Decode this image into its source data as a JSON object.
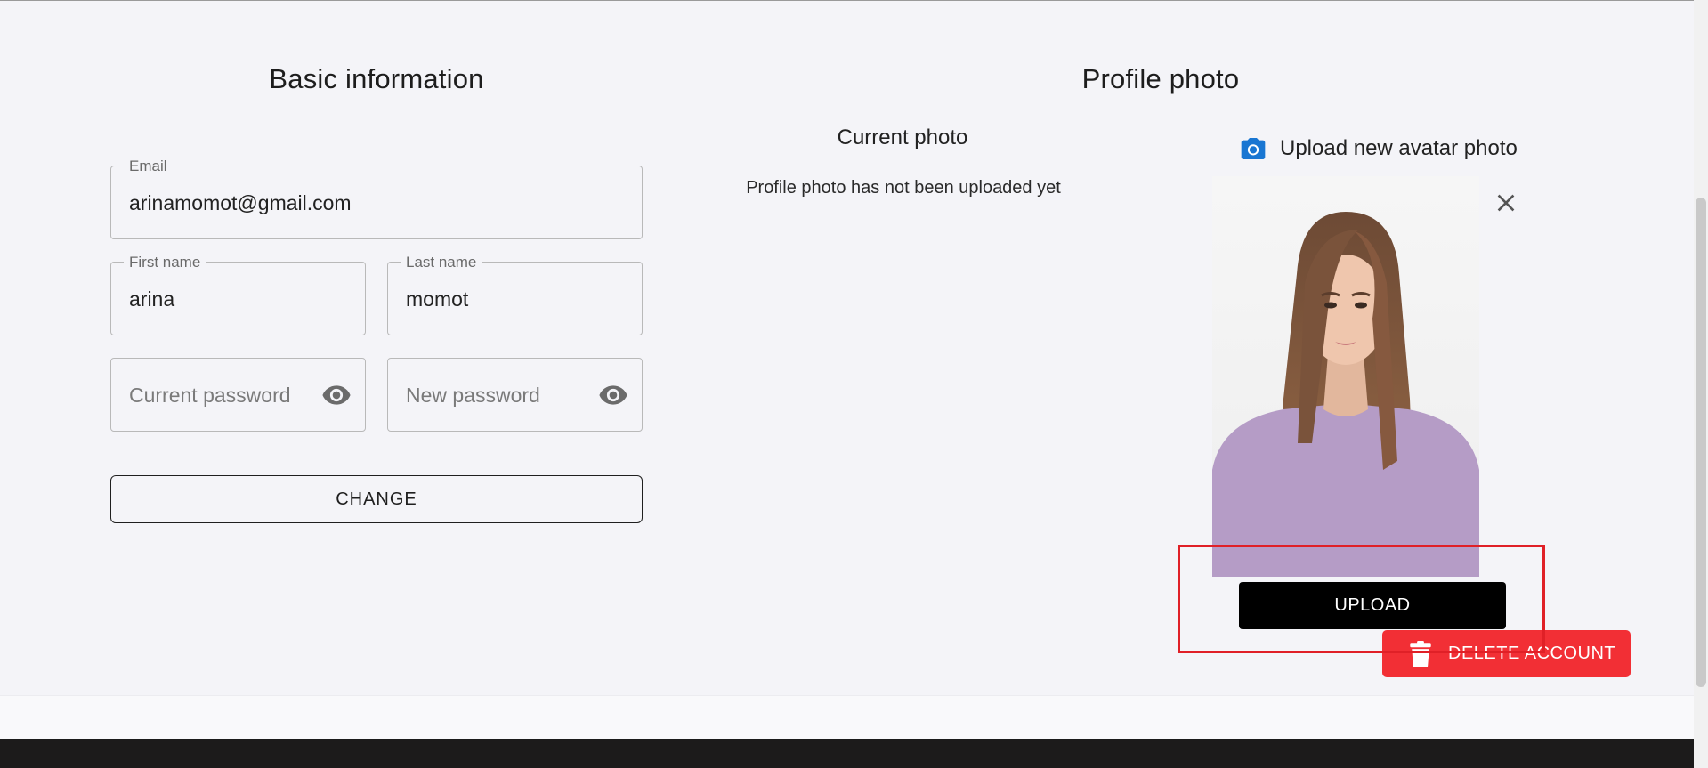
{
  "basic_info": {
    "title": "Basic information",
    "email": {
      "label": "Email",
      "value": "arinamomot@gmail.com"
    },
    "first_name": {
      "label": "First name",
      "value": "arina"
    },
    "last_name": {
      "label": "Last name",
      "value": "momot"
    },
    "current_password": {
      "placeholder": "Current password",
      "icon": "eye-icon"
    },
    "new_password": {
      "placeholder": "New password",
      "icon": "eye-icon"
    },
    "change_label": "CHANGE"
  },
  "profile_photo": {
    "title": "Profile photo",
    "current_photo_title": "Current photo",
    "no_photo_text": "Profile photo has not been uploaded yet",
    "upload_new_label": "Upload new avatar photo",
    "upload_icon": "camera-icon",
    "close_icon": "close-icon",
    "upload_label": "UPLOAD"
  },
  "account": {
    "delete_label": "DELETE ACCOUNT",
    "delete_icon": "trash-icon"
  },
  "colors": {
    "accent_blue": "#1976d2",
    "danger_red": "#f22f35",
    "highlight_red": "#e02027",
    "upload_black": "#000000"
  }
}
